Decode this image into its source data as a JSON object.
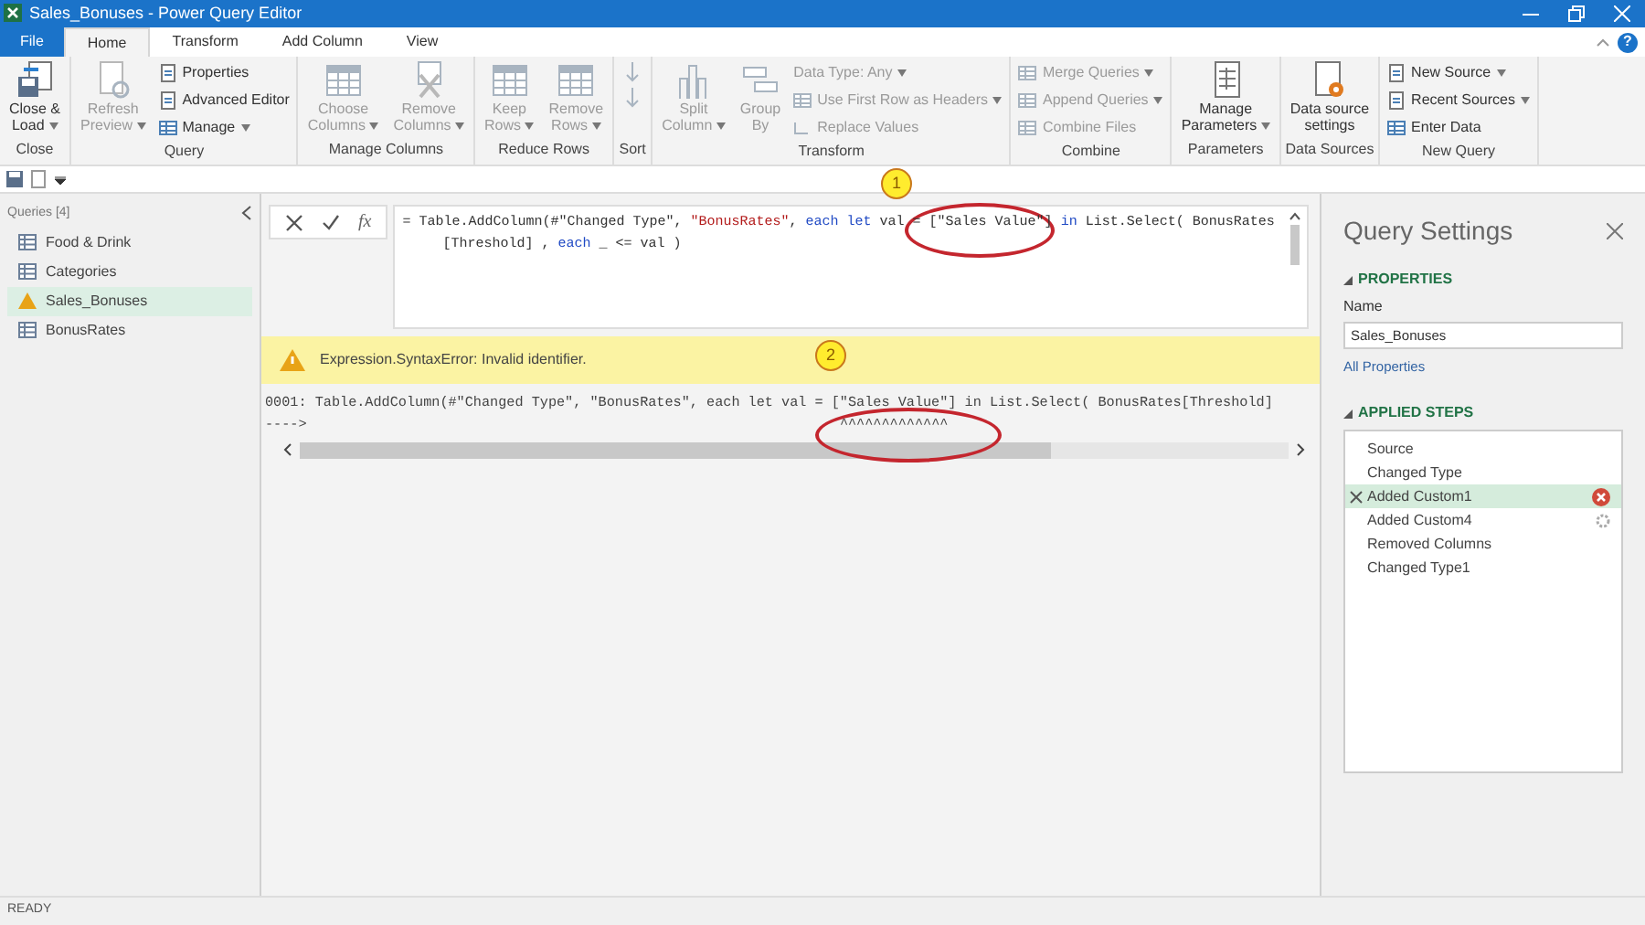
{
  "window": {
    "title": "Sales_Bonuses - Power Query Editor"
  },
  "menu_tabs": [
    {
      "label": "File",
      "kind": "file",
      "selected": false
    },
    {
      "label": "Home",
      "kind": "tab",
      "selected": true
    },
    {
      "label": "Transform",
      "kind": "tab",
      "selected": false
    },
    {
      "label": "Add Column",
      "kind": "tab",
      "selected": false
    },
    {
      "label": "View",
      "kind": "tab",
      "selected": false
    }
  ],
  "help": "?",
  "ribbon": {
    "groups": [
      {
        "label": "Close",
        "buttons": [
          {
            "kind": "large",
            "lines": [
              "Close &",
              "Load"
            ],
            "dropdown": true,
            "disabled": false
          }
        ]
      },
      {
        "label": "Query",
        "buttons": [
          {
            "kind": "large",
            "lines": [
              "Refresh",
              "Preview"
            ],
            "dropdown": true,
            "disabled": true
          },
          {
            "kind": "small",
            "lines": [
              "Properties"
            ],
            "dropdown": false,
            "disabled": false
          },
          {
            "kind": "small",
            "lines": [
              "Advanced Editor"
            ],
            "dropdown": false,
            "disabled": false
          },
          {
            "kind": "small",
            "lines": [
              "Manage"
            ],
            "dropdown": true,
            "disabled": false
          }
        ]
      },
      {
        "label": "Manage Columns",
        "buttons": [
          {
            "kind": "large",
            "lines": [
              "Choose",
              "Columns"
            ],
            "dropdown": true,
            "disabled": true
          },
          {
            "kind": "large",
            "lines": [
              "Remove",
              "Columns"
            ],
            "dropdown": true,
            "disabled": true
          }
        ]
      },
      {
        "label": "Reduce Rows",
        "buttons": [
          {
            "kind": "large",
            "lines": [
              "Keep",
              "Rows"
            ],
            "dropdown": true,
            "disabled": true
          },
          {
            "kind": "large",
            "lines": [
              "Remove",
              "Rows"
            ],
            "dropdown": true,
            "disabled": true
          }
        ]
      },
      {
        "label": "Sort",
        "buttons": [
          {
            "kind": "icon",
            "dropdown": false,
            "disabled": true
          },
          {
            "kind": "icon",
            "dropdown": false,
            "disabled": true
          }
        ]
      },
      {
        "label": "Transform",
        "buttons": [
          {
            "kind": "large",
            "lines": [
              "Split",
              "Column"
            ],
            "dropdown": true,
            "disabled": true
          },
          {
            "kind": "large",
            "lines": [
              "Group",
              "By"
            ],
            "dropdown": false,
            "disabled": true
          },
          {
            "kind": "small",
            "lines": [
              "Data Type: Any"
            ],
            "dropdown": true,
            "disabled": true
          },
          {
            "kind": "small",
            "lines": [
              "Use First Row as Headers"
            ],
            "dropdown": true,
            "disabled": true
          },
          {
            "kind": "small",
            "lines": [
              "Replace Values"
            ],
            "dropdown": false,
            "disabled": true
          }
        ]
      },
      {
        "label": "Combine",
        "buttons": [
          {
            "kind": "small",
            "lines": [
              "Merge Queries"
            ],
            "dropdown": true,
            "disabled": true
          },
          {
            "kind": "small",
            "lines": [
              "Append Queries"
            ],
            "dropdown": true,
            "disabled": true
          },
          {
            "kind": "small",
            "lines": [
              "Combine Files"
            ],
            "dropdown": false,
            "disabled": true
          }
        ]
      },
      {
        "label": "Parameters",
        "buttons": [
          {
            "kind": "large",
            "lines": [
              "Manage",
              "Parameters"
            ],
            "dropdown": true,
            "disabled": false
          }
        ]
      },
      {
        "label": "Data Sources",
        "buttons": [
          {
            "kind": "large",
            "lines": [
              "Data source",
              "settings"
            ],
            "dropdown": false,
            "disabled": false
          }
        ]
      },
      {
        "label": "New Query",
        "buttons": [
          {
            "kind": "small",
            "lines": [
              "New Source"
            ],
            "dropdown": true,
            "disabled": false
          },
          {
            "kind": "small",
            "lines": [
              "Recent Sources"
            ],
            "dropdown": true,
            "disabled": false
          },
          {
            "kind": "small",
            "lines": [
              "Enter Data"
            ],
            "dropdown": false,
            "disabled": false
          }
        ]
      }
    ]
  },
  "queries": {
    "header": "Queries [4]",
    "items": [
      {
        "label": "Food & Drink",
        "kind": "table",
        "selected": false
      },
      {
        "label": "Categories",
        "kind": "table",
        "selected": false
      },
      {
        "label": "Sales_Bonuses",
        "kind": "warning",
        "selected": true
      },
      {
        "label": "BonusRates",
        "kind": "table",
        "selected": false
      }
    ]
  },
  "formula": {
    "fx": "fx",
    "lines": [
      [
        {
          "text": "= Table.AddColumn(#\"Changed Type\", ",
          "kind": "plain"
        },
        {
          "text": "\"BonusRates\"",
          "kind": "string"
        },
        {
          "text": ", ",
          "kind": "plain"
        },
        {
          "text": "each let",
          "kind": "keyword"
        },
        {
          "text": " val = [\"Sales Value\"] ",
          "kind": "plain"
        },
        {
          "text": "in",
          "kind": "keyword"
        },
        {
          "text": " List.Select( BonusRates",
          "kind": "plain"
        }
      ],
      [
        {
          "text": "[Threshold] , ",
          "kind": "plain"
        },
        {
          "text": "each",
          "kind": "keyword"
        },
        {
          "text": " _ <= val )",
          "kind": "plain"
        }
      ]
    ]
  },
  "error": {
    "message": "Expression.SyntaxError: Invalid identifier.",
    "detail": "0001: Table.AddColumn(#\"Changed Type\", \"BonusRates\", each let val = [\"Sales Value\"] in List.Select( BonusRates[Threshold]",
    "pointer": "---->",
    "carets": "^^^^^^^^^^^^^"
  },
  "annotations": [
    {
      "label": "1"
    },
    {
      "label": "2"
    }
  ],
  "settings": {
    "title": "Query Settings",
    "properties": {
      "heading": "PROPERTIES",
      "expanded": true,
      "name_label": "Name",
      "name_value": "Sales_Bonuses",
      "link": "All Properties"
    },
    "steps": {
      "heading": "APPLIED STEPS",
      "expanded": true,
      "items": [
        {
          "label": "Source",
          "selected": false,
          "kind": "plain"
        },
        {
          "label": "Changed Type",
          "selected": false,
          "kind": "plain"
        },
        {
          "label": "Added Custom1",
          "selected": true,
          "kind": "error"
        },
        {
          "label": "Added Custom4",
          "selected": false,
          "kind": "settings"
        },
        {
          "label": "Removed Columns",
          "selected": false,
          "kind": "plain"
        },
        {
          "label": "Changed Type1",
          "selected": false,
          "kind": "plain"
        }
      ]
    }
  },
  "status_bar": {
    "text": "READY"
  }
}
